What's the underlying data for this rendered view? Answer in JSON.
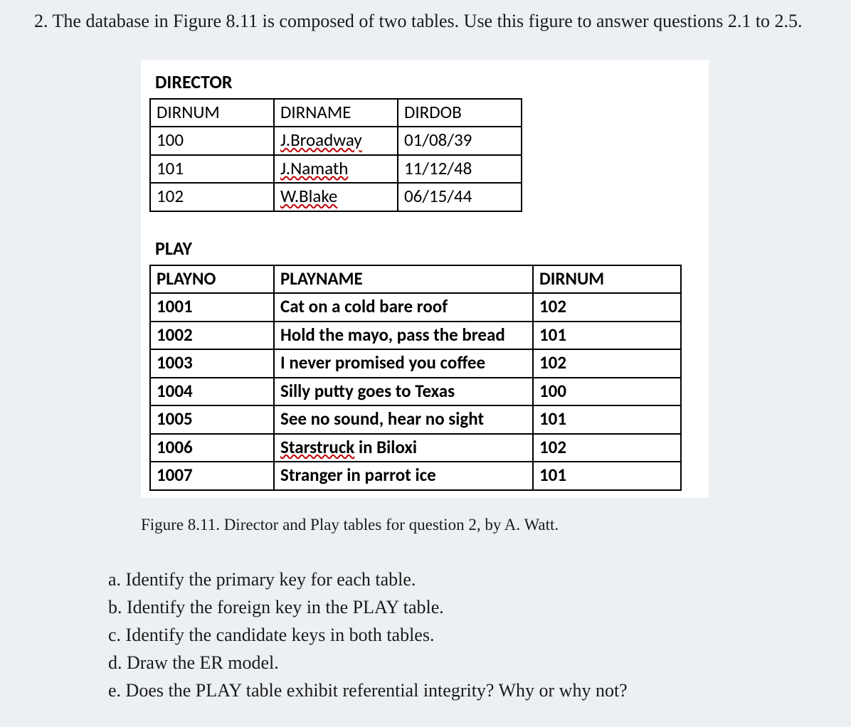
{
  "problem_stem": "2. The database in Figure 8.11 is composed of two tables. Use this figure to answer questions 2.1 to 2.5.",
  "tables": {
    "director": {
      "title": "DIRECTOR",
      "columns": [
        "DIRNUM",
        "DIRNAME",
        "DIRDOB"
      ],
      "rows": [
        {
          "dirnum": "100",
          "dirname": "J.Broadway",
          "dirname_spell": true,
          "dirdob": "01/08/39"
        },
        {
          "dirnum": "101",
          "dirname": "J.Namath",
          "dirname_spell": true,
          "dirdob": "11/12/48"
        },
        {
          "dirnum": "102",
          "dirname": "W.Blake",
          "dirname_spell": true,
          "dirdob": "06/15/44"
        }
      ]
    },
    "play": {
      "title": "PLAY",
      "columns": [
        "PLAYNO",
        "PLAYNAME",
        "DIRNUM"
      ],
      "rows": [
        {
          "playno": "1001",
          "playname_pre": "",
          "playname_spell": "",
          "playname_post": "Cat on a cold bare roof",
          "dirnum": "102"
        },
        {
          "playno": "1002",
          "playname_pre": "",
          "playname_spell": "",
          "playname_post": "Hold the mayo, pass the bread",
          "dirnum": "101"
        },
        {
          "playno": "1003",
          "playname_pre": "",
          "playname_spell": "",
          "playname_post": "I never promised you coffee",
          "dirnum": "102"
        },
        {
          "playno": "1004",
          "playname_pre": "",
          "playname_spell": "",
          "playname_post": "Silly putty goes to Texas",
          "dirnum": "100"
        },
        {
          "playno": "1005",
          "playname_pre": "",
          "playname_spell": "",
          "playname_post": "See no sound, hear no sight",
          "dirnum": "101"
        },
        {
          "playno": "1006",
          "playname_pre": "",
          "playname_spell": "Starstruck",
          "playname_post": " in Biloxi",
          "dirnum": "102"
        },
        {
          "playno": "1007",
          "playname_pre": "",
          "playname_spell": "",
          "playname_post": "Stranger in parrot ice",
          "dirnum": "101"
        }
      ]
    }
  },
  "caption": "Figure 8.11. Director and Play tables for question 2, by A. Watt.",
  "sub_questions": {
    "a": "a. Identify the primary key for each table.",
    "b": "b. Identify the foreign key in the PLAY table.",
    "c": "c. Identify the candidate keys in both tables.",
    "d": "d. Draw the ER model.",
    "e": "e. Does the PLAY table exhibit referential integrity? Why or why not?"
  }
}
